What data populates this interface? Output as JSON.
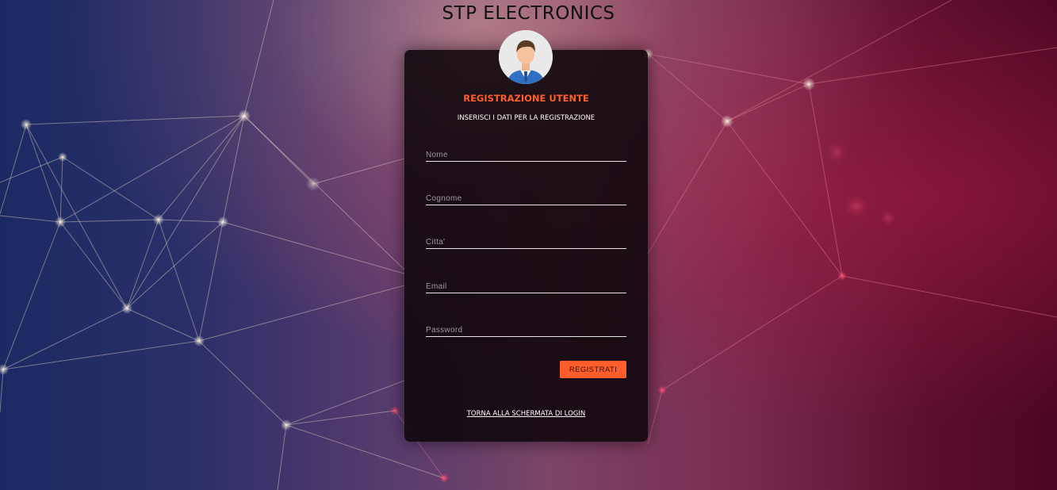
{
  "app": {
    "brand_title": "STP ELECTRONICS"
  },
  "registration_card": {
    "title": "REGISTRAZIONE UTENTE",
    "subtitle": "INSERISCI I DATI PER LA REGISTRAZIONE",
    "avatar_icon": "user-avatar-icon",
    "fields": {
      "nome": {
        "placeholder": "Nome",
        "value": ""
      },
      "cognome": {
        "placeholder": "Cognome",
        "value": ""
      },
      "citta": {
        "placeholder": "Citta'",
        "value": ""
      },
      "email": {
        "placeholder": "Email",
        "value": ""
      },
      "password": {
        "placeholder": "Password",
        "value": ""
      }
    },
    "register_button_label": "REGISTRATI",
    "back_to_login_label": "TORNA ALLA SCHERMATA DI LOGIN"
  },
  "colors": {
    "accent": "#ff5e2c",
    "card_background": "#0c060a",
    "field_underline": "#e6e6e6",
    "background_left": "#1c2a63",
    "background_right": "#4a0622"
  }
}
